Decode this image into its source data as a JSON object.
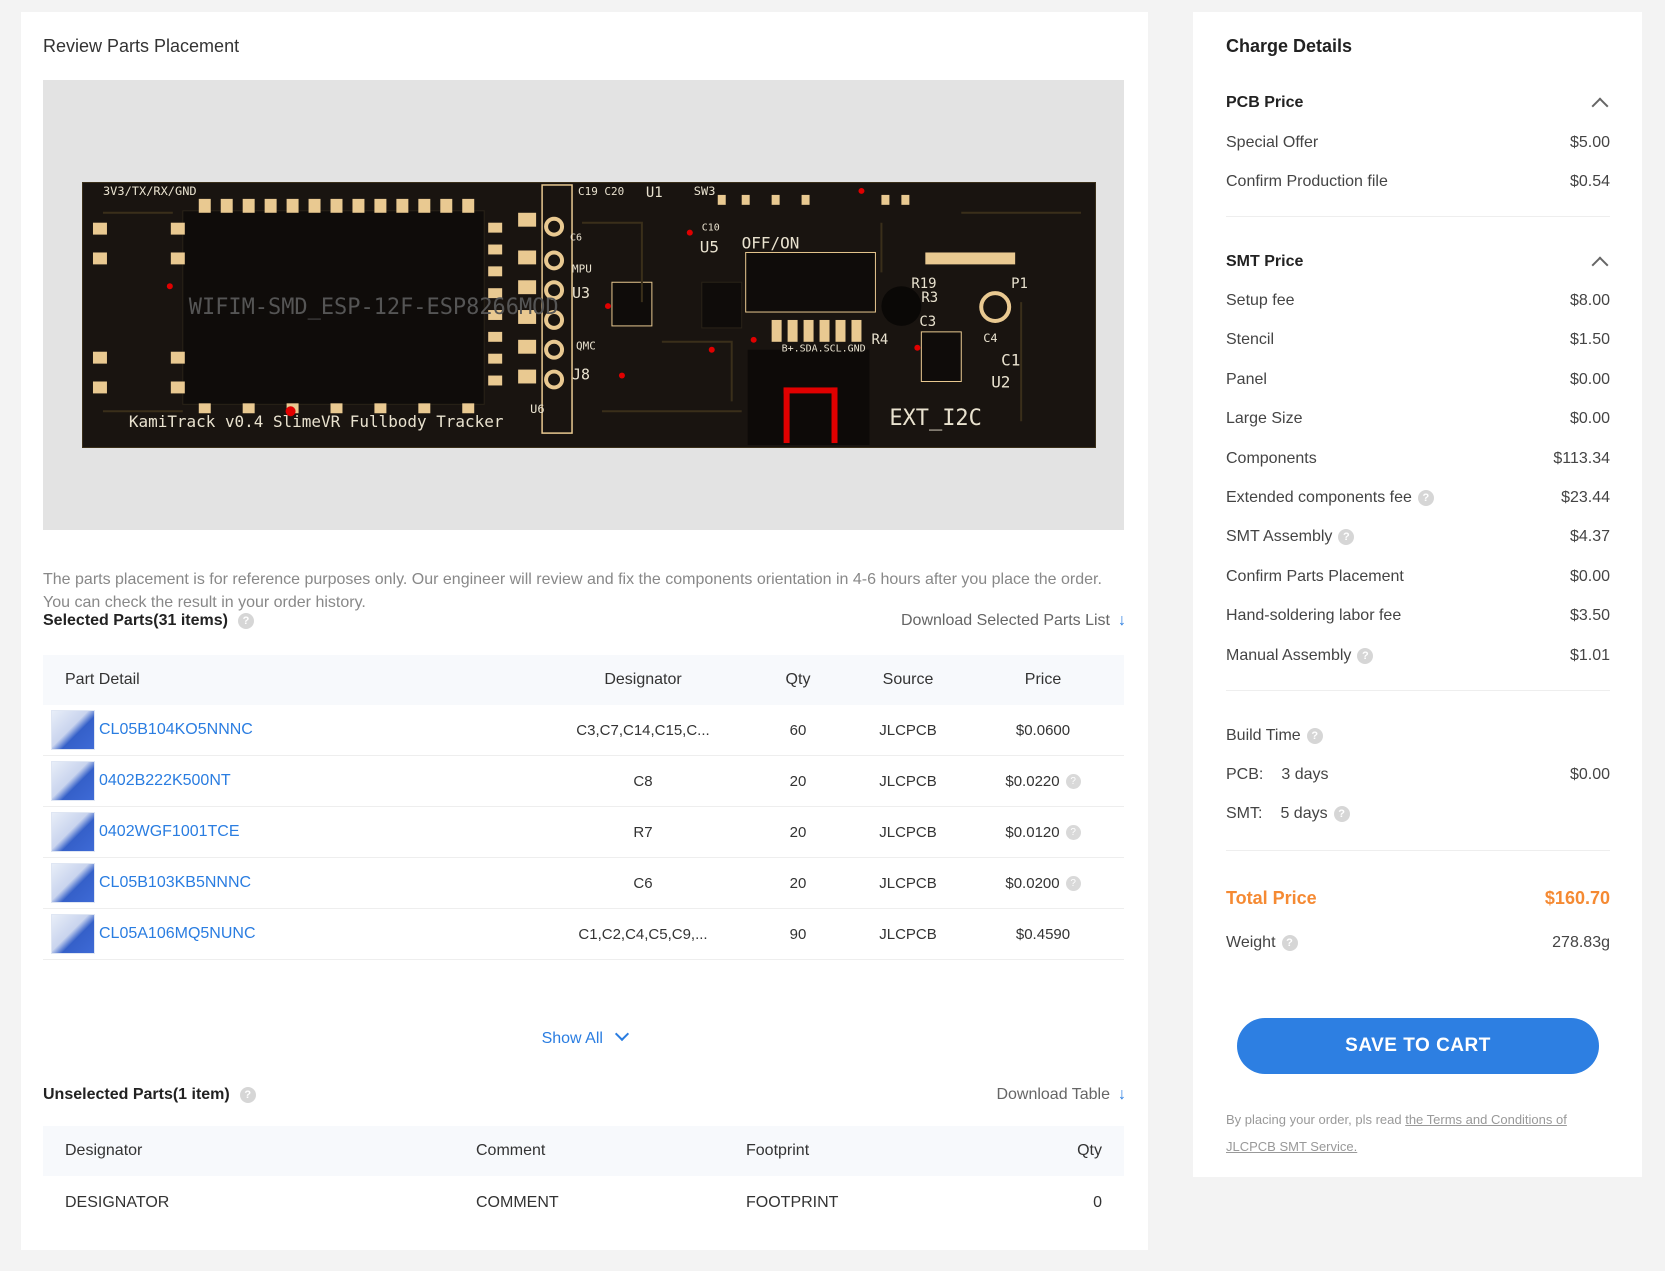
{
  "review": {
    "title": "Review Parts Placement",
    "note": "The parts placement is for reference purposes only. Our engineer will review and fix the components orientation in 4-6 hours after you place the order. You can check the result in your order history."
  },
  "pcb": {
    "labels": {
      "module": "WIFIM-SMD_ESP-12F-ESP8266MOD",
      "tracker": "KamiTrack v0.4 SlimeVR Fullbody Tracker",
      "header": "3V3/TX/RX/GND",
      "offon": "OFF/ON",
      "ext": "EXT_I2C",
      "bus": "B+.SDA.SCL.GND",
      "u1": "U1",
      "sw3": "SW3",
      "u5": "U5",
      "u3": "U3",
      "u6": "U6",
      "u2": "U2",
      "p1": "P1",
      "c19c20": "C19 C20",
      "j8": "J8",
      "r19": "R19",
      "r3": "R3",
      "c3": "C3",
      "c4": "C4",
      "r4": "R4",
      "c1": "C1",
      "mpu": "MPU",
      "qmc": "QMC",
      "c6": "C6",
      "c10": "C10"
    }
  },
  "selected": {
    "title": "Selected Parts(31 items)",
    "download": "Download Selected Parts List",
    "headers": {
      "part": "Part Detail",
      "designator": "Designator",
      "qty": "Qty",
      "source": "Source",
      "price": "Price"
    },
    "rows": [
      {
        "part": "CL05B104KO5NNNC",
        "designator": "C3,C7,C14,C15,C...",
        "qty": "60",
        "source": "JLCPCB",
        "price": "$0.0600"
      },
      {
        "part": "0402B222K500NT",
        "designator": "C8",
        "qty": "20",
        "source": "JLCPCB",
        "price": "$0.0220"
      },
      {
        "part": "0402WGF1001TCE",
        "designator": "R7",
        "qty": "20",
        "source": "JLCPCB",
        "price": "$0.0120"
      },
      {
        "part": "CL05B103KB5NNNC",
        "designator": "C6",
        "qty": "20",
        "source": "JLCPCB",
        "price": "$0.0200"
      },
      {
        "part": "CL05A106MQ5NUNC",
        "designator": "C1,C2,C4,C5,C9,...",
        "qty": "90",
        "source": "JLCPCB",
        "price": "$0.4590"
      }
    ],
    "show_all": "Show All"
  },
  "unselected": {
    "title": "Unselected Parts(1 item)",
    "download": "Download Table",
    "headers": {
      "designator": "Designator",
      "comment": "Comment",
      "footprint": "Footprint",
      "qty": "Qty"
    },
    "row": {
      "designator": "DESIGNATOR",
      "comment": "COMMENT",
      "footprint": "FOOTPRINT",
      "qty": "0"
    }
  },
  "charges": {
    "title": "Charge Details",
    "pcb_price": {
      "title": "PCB Price",
      "items": [
        {
          "label": "Special Offer",
          "value": "$5.00"
        },
        {
          "label": "Confirm Production file",
          "value": "$0.54"
        }
      ]
    },
    "smt_price": {
      "title": "SMT Price",
      "items": [
        {
          "label": "Setup fee",
          "value": "$8.00"
        },
        {
          "label": "Stencil",
          "value": "$1.50"
        },
        {
          "label": "Panel",
          "value": "$0.00"
        },
        {
          "label": "Large Size",
          "value": "$0.00"
        },
        {
          "label": "Components",
          "value": "$113.34"
        },
        {
          "label": "Extended components fee",
          "value": "$23.44"
        },
        {
          "label": "SMT Assembly",
          "value": "$4.37"
        },
        {
          "label": "Confirm Parts Placement",
          "value": "$0.00"
        },
        {
          "label": "Hand-soldering labor fee",
          "value": "$3.50"
        },
        {
          "label": "Manual Assembly",
          "value": "$1.01"
        }
      ]
    },
    "build_time": {
      "label": "Build Time",
      "pcb_label": "PCB:",
      "pcb_days": "3 days",
      "pcb_value": "$0.00",
      "smt_label": "SMT:",
      "smt_days": "5 days"
    },
    "total": {
      "label": "Total Price",
      "value": "$160.70"
    },
    "weight": {
      "label": "Weight",
      "value": "278.83g"
    },
    "cart_button": "SAVE TO CART",
    "terms_prefix": "By placing your order, pls read ",
    "terms_link": "the Terms and Conditions of JLCPCB SMT Service."
  }
}
